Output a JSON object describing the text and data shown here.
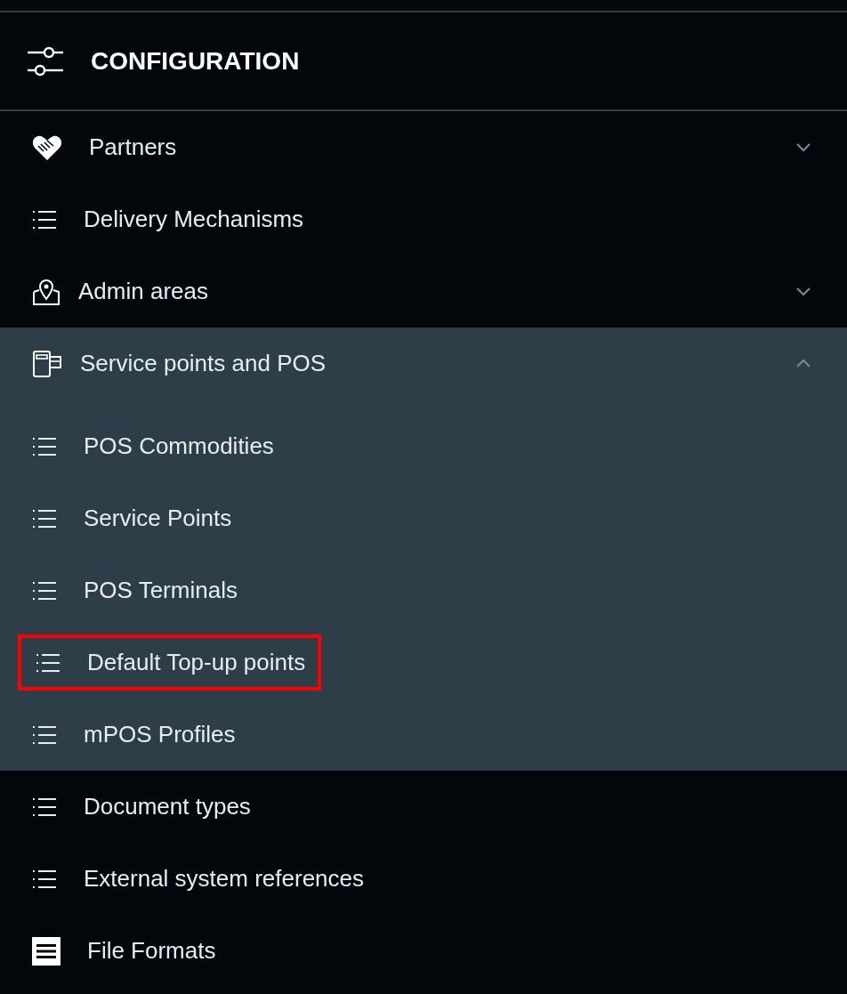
{
  "header": {
    "title": "CONFIGURATION"
  },
  "items": [
    {
      "label": "Partners",
      "kind": "group",
      "expanded": false
    },
    {
      "label": "Delivery Mechanisms",
      "kind": "link"
    },
    {
      "label": "Admin areas",
      "kind": "group",
      "expanded": false
    },
    {
      "label": "Service points and POS",
      "kind": "group",
      "expanded": true,
      "children": [
        {
          "label": "POS Commodities",
          "highlighted": false
        },
        {
          "label": "Service Points",
          "highlighted": false
        },
        {
          "label": "POS Terminals",
          "highlighted": false
        },
        {
          "label": "Default Top-up points",
          "highlighted": true
        },
        {
          "label": "mPOS Profiles",
          "highlighted": false
        }
      ]
    },
    {
      "label": "Document types",
      "kind": "link"
    },
    {
      "label": "External system references",
      "kind": "link"
    },
    {
      "label": "File Formats",
      "kind": "link"
    }
  ]
}
